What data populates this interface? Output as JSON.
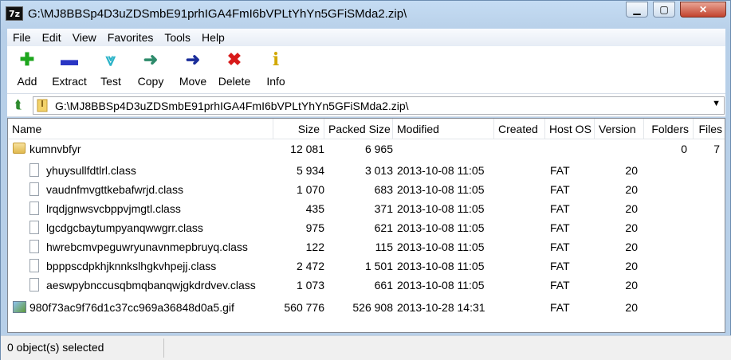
{
  "window": {
    "app_icon": "7z",
    "title": "G:\\MJ8BBSp4D3uZDSmbE91prhIGA4FmI6bVPLtYhYn5GFiSMda2.zip\\",
    "min_icon": "minimize-icon",
    "max_icon": "maximize-icon",
    "close_icon": "close-icon",
    "close_glyph": "✕"
  },
  "menu": [
    "File",
    "Edit",
    "View",
    "Favorites",
    "Tools",
    "Help"
  ],
  "toolbar": [
    {
      "label": "Add",
      "icon": "plus-icon",
      "glyph": "✚",
      "color": "#1da61d"
    },
    {
      "label": "Extract",
      "icon": "minus-icon",
      "glyph": "▬",
      "color": "#2a36c4"
    },
    {
      "label": "Test",
      "icon": "check-icon",
      "glyph": "⩔",
      "color": "#2bb3c8"
    },
    {
      "label": "Copy",
      "icon": "copy-arrow-icon",
      "glyph": "➜",
      "color": "#2e8b6b"
    },
    {
      "label": "Move",
      "icon": "move-arrow-icon",
      "glyph": "➜",
      "color": "#1a2d9a"
    },
    {
      "label": "Delete",
      "icon": "delete-x-icon",
      "glyph": "✖",
      "color": "#d81a1a"
    },
    {
      "label": "Info",
      "icon": "info-icon",
      "glyph": "i",
      "color": "#d2a800"
    }
  ],
  "address": {
    "path": "G:\\MJ8BBSp4D3uZDSmbE91prhIGA4FmI6bVPLtYhYn5GFiSMda2.zip\\",
    "up_icon": "up-folder-icon",
    "dropdown_icon": "chevron-down-icon"
  },
  "columns": [
    "Name",
    "Size",
    "Packed Size",
    "Modified",
    "Created",
    "Host OS",
    "Version",
    "Folders",
    "Files"
  ],
  "rows": [
    {
      "type": "folder",
      "name": "kumnvbfyr",
      "size": "12 081",
      "packed": "6 965",
      "modified": "",
      "created": "",
      "host": "",
      "version": "",
      "folders": "0",
      "files": "7"
    },
    {
      "type": "file",
      "name": "yhuysullfdtlrl.class",
      "size": "5 934",
      "packed": "3 013",
      "modified": "2013-10-08 11:05",
      "created": "",
      "host": "FAT",
      "version": "20",
      "folders": "",
      "files": ""
    },
    {
      "type": "file",
      "name": "vaudnfmvgttkebafwrjd.class",
      "size": "1 070",
      "packed": "683",
      "modified": "2013-10-08 11:05",
      "created": "",
      "host": "FAT",
      "version": "20",
      "folders": "",
      "files": ""
    },
    {
      "type": "file",
      "name": "lrqdjgnwsvcbppvjmgtl.class",
      "size": "435",
      "packed": "371",
      "modified": "2013-10-08 11:05",
      "created": "",
      "host": "FAT",
      "version": "20",
      "folders": "",
      "files": ""
    },
    {
      "type": "file",
      "name": "lgcdgcbaytumpyanqwwgrr.class",
      "size": "975",
      "packed": "621",
      "modified": "2013-10-08 11:05",
      "created": "",
      "host": "FAT",
      "version": "20",
      "folders": "",
      "files": ""
    },
    {
      "type": "file",
      "name": "hwrebcmvpeguwryunavnmepbruyq.class",
      "size": "122",
      "packed": "115",
      "modified": "2013-10-08 11:05",
      "created": "",
      "host": "FAT",
      "version": "20",
      "folders": "",
      "files": ""
    },
    {
      "type": "file",
      "name": "bpppscdpkhjknnkslhgkvhpejj.class",
      "size": "2 472",
      "packed": "1 501",
      "modified": "2013-10-08 11:05",
      "created": "",
      "host": "FAT",
      "version": "20",
      "folders": "",
      "files": ""
    },
    {
      "type": "file",
      "name": "aeswpybnccusqbmqbanqwjgkdrdvev.class",
      "size": "1 073",
      "packed": "661",
      "modified": "2013-10-08 11:05",
      "created": "",
      "host": "FAT",
      "version": "20",
      "folders": "",
      "files": ""
    },
    {
      "type": "image",
      "name": "980f73ac9f76d1c37cc969a36848d0a5.gif",
      "size": "560 776",
      "packed": "526 908",
      "modified": "2013-10-28 14:31",
      "created": "",
      "host": "FAT",
      "version": "20",
      "folders": "",
      "files": ""
    }
  ],
  "status": {
    "selected": "0 object(s) selected"
  }
}
